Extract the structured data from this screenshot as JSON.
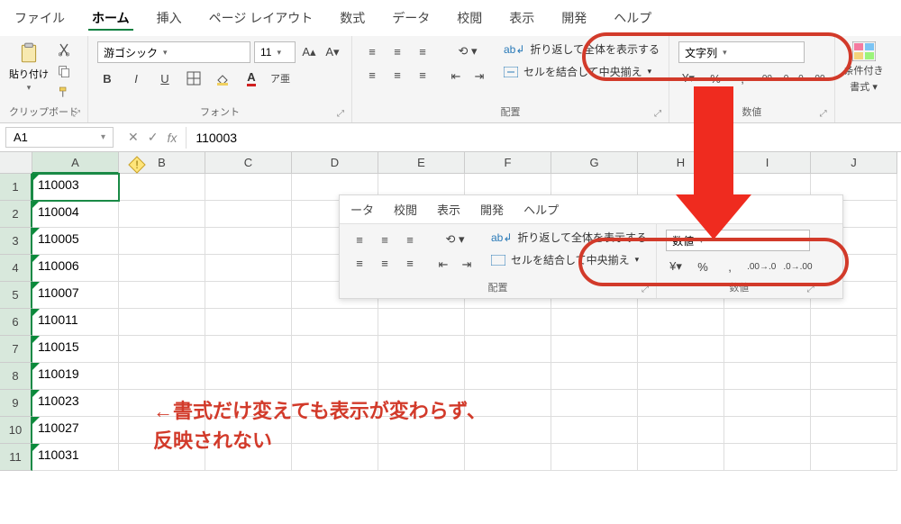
{
  "menu": {
    "tabs": [
      "ファイル",
      "ホーム",
      "挿入",
      "ページ レイアウト",
      "数式",
      "データ",
      "校閲",
      "表示",
      "開発",
      "ヘルプ"
    ],
    "active": 1
  },
  "clipboard": {
    "paste_label": "貼り付け",
    "group_label": "クリップボード"
  },
  "font": {
    "family": "游ゴシック",
    "size": "11",
    "group_label": "フォント",
    "bold": "B",
    "italic": "I",
    "underline": "U"
  },
  "alignment": {
    "group_label": "配置",
    "wrap_text": "折り返して全体を表示する",
    "merge_center": "セルを結合して中央揃え"
  },
  "number": {
    "group_label": "数値",
    "format_top": "文字列",
    "format_overlay": "数値"
  },
  "cond_format": {
    "label1": "条件付き",
    "label2": "書式"
  },
  "namebox": {
    "ref": "A1",
    "formula_value": "110003"
  },
  "columns": [
    "A",
    "B",
    "C",
    "D",
    "E",
    "F",
    "G",
    "H",
    "I",
    "J"
  ],
  "cells": {
    "a": [
      "110003",
      "110004",
      "110005",
      "110006",
      "110007",
      "110011",
      "110015",
      "110019",
      "110023",
      "110027",
      "110031"
    ]
  },
  "overlay_menu": [
    "ータ",
    "校閲",
    "表示",
    "開発",
    "ヘルプ"
  ],
  "annotation": {
    "line1": "←書式だけ変えても表示が変わらず、",
    "line2": "反映されない"
  }
}
